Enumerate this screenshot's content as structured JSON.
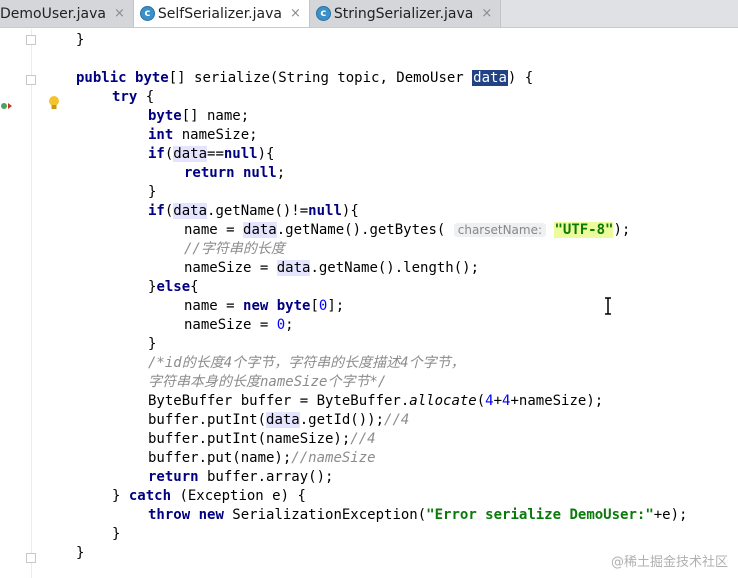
{
  "tabs": [
    {
      "label": "DemoUser.java",
      "close": "×"
    },
    {
      "label": "SelfSerializer.java",
      "close": "×"
    },
    {
      "label": "StringSerializer.java",
      "close": "×"
    }
  ],
  "code": {
    "l1": "}",
    "l2_public": "public",
    "l2_byte": "byte",
    "l2_mid": "[] serialize(String topic, DemoUser ",
    "l2_param": "data",
    "l2_end": ") {",
    "l3": "try",
    "l3_end": " {",
    "l4_kw": "byte",
    "l4_rest": "[] name;",
    "l5_kw": "int",
    "l5_rest": " nameSize;",
    "l6_if": "if",
    "l6_open": "(",
    "l6_data": "data",
    "l6_eq": "==",
    "l6_null": "null",
    "l6_end": "){",
    "l7_ret": "return",
    "l7_null": " null",
    "l7_end": ";",
    "l8": "}",
    "l9_if": "if",
    "l9_open": "(",
    "l9_data": "data",
    "l9_mid": ".getName()!=",
    "l9_null": "null",
    "l9_end": "){",
    "l10_a": "name = ",
    "l10_data": "data",
    "l10_b": ".getName().getBytes( ",
    "l10_hint": "charsetName:",
    "l10_str": "\"UTF-8\"",
    "l10_end": ");",
    "l11": "//字符串的长度",
    "l12_a": "nameSize = ",
    "l12_data": "data",
    "l12_b": ".getName().length();",
    "l13_a": "}",
    "l13_else": "else",
    "l13_b": "{",
    "l14_a": "name = ",
    "l14_new": "new",
    "l14_byte": " byte",
    "l14_b": "[",
    "l14_num": "0",
    "l14_c": "];",
    "l15_a": "nameSize = ",
    "l15_num": "0",
    "l15_b": ";",
    "l16": "}",
    "l17": "/*id的长度4个字节，字符串的长度描述4个字节，",
    "l18_a": "字符串本身的长度",
    "l18_b": "nameSize",
    "l18_c": "个字节*/",
    "l19_a": "ByteBuffer buffer = ByteBuffer.",
    "l19_it": "allocate",
    "l19_b": "(",
    "l19_n1": "4",
    "l19_p": "+",
    "l19_n2": "4",
    "l19_c": "+nameSize);",
    "l20_a": "buffer.putInt(",
    "l20_data": "data",
    "l20_b": ".getId());",
    "l20_cm": "//4",
    "l21_a": "buffer.putInt(nameSize);",
    "l21_cm": "//4",
    "l22_a": "buffer.put(name);",
    "l22_cm": "//nameSize",
    "l23_ret": "return",
    "l23_b": " buffer.array();",
    "l24_a": "} ",
    "l24_catch": "catch",
    "l24_b": " (Exception e) {",
    "l25_throw": "throw",
    "l25_new": " new",
    "l25_a": " SerializationException(",
    "l25_str": "\"Error serialize DemoUser:\"",
    "l25_b": "+e);",
    "l26": "}",
    "l27": "}"
  },
  "watermark": "@稀土掘金技术社区",
  "colors": {
    "keyword": "#000080",
    "string": "#0a7a0a",
    "comment": "#8c8c8c",
    "number": "#0000ff",
    "selection": "#214283"
  },
  "icons": [
    "class-c-icon",
    "lightbulb-icon",
    "override-marker-icon",
    "fold-icon",
    "text-cursor-icon",
    "close-icon"
  ]
}
